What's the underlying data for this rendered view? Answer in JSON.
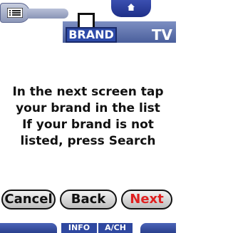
{
  "header": {
    "brand_tab": "BRAND",
    "device": "TV"
  },
  "message": {
    "lines": [
      "In the next screen tap",
      "your brand in the list",
      "If your brand is not",
      "listed, press Search"
    ]
  },
  "buttons": {
    "cancel": "Cancel",
    "back": "Back",
    "next": "Next"
  },
  "bottom": {
    "info": "INFO",
    "ach": "A/CH"
  },
  "icons": {
    "menu": "menu-list-icon",
    "home": "home-icon",
    "device": "device-frame-icon"
  },
  "colors": {
    "accent_blue": "#2d4aa8",
    "next_red": "#e02020"
  }
}
